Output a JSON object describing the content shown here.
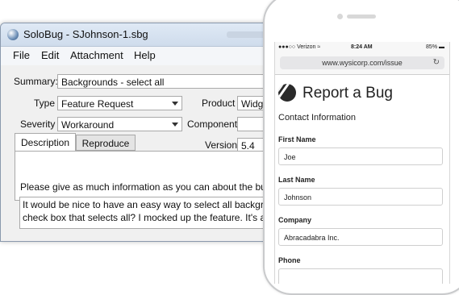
{
  "window": {
    "title": "SoloBug - SJohnson-1.sbg",
    "menu": [
      "File",
      "Edit",
      "Attachment",
      "Help"
    ]
  },
  "form": {
    "summary_label": "Summary:",
    "summary_value": "Backgrounds - select all",
    "type_label": "Type",
    "type_value": "Feature Request",
    "product_label": "Product",
    "product_value": "Widge",
    "severity_label": "Severity",
    "severity_value": "Workaround",
    "component_label": "Component",
    "component_value": "",
    "version_label": "Version",
    "version_value": "5.4"
  },
  "tabs": [
    "Description",
    "Reproduce"
  ],
  "description": {
    "prompt": "Please give as much information as you can about the bug or f",
    "text": "It would be nice to have an easy way to select all backgrounds\ncheck box that selects all? I mocked up the feature. It's attach"
  },
  "phone": {
    "status": {
      "carrier": "Verizon",
      "time": "8:24 AM",
      "battery": "85%"
    },
    "url": "www.wysicorp.com/issue",
    "heading": "Report a Bug",
    "section": "Contact Information",
    "fields": [
      {
        "label": "First Name",
        "value": "Joe"
      },
      {
        "label": "Last Name",
        "value": "Johnson"
      },
      {
        "label": "Company",
        "value": "Abracadabra Inc."
      },
      {
        "label": "Phone",
        "value": ""
      }
    ]
  }
}
